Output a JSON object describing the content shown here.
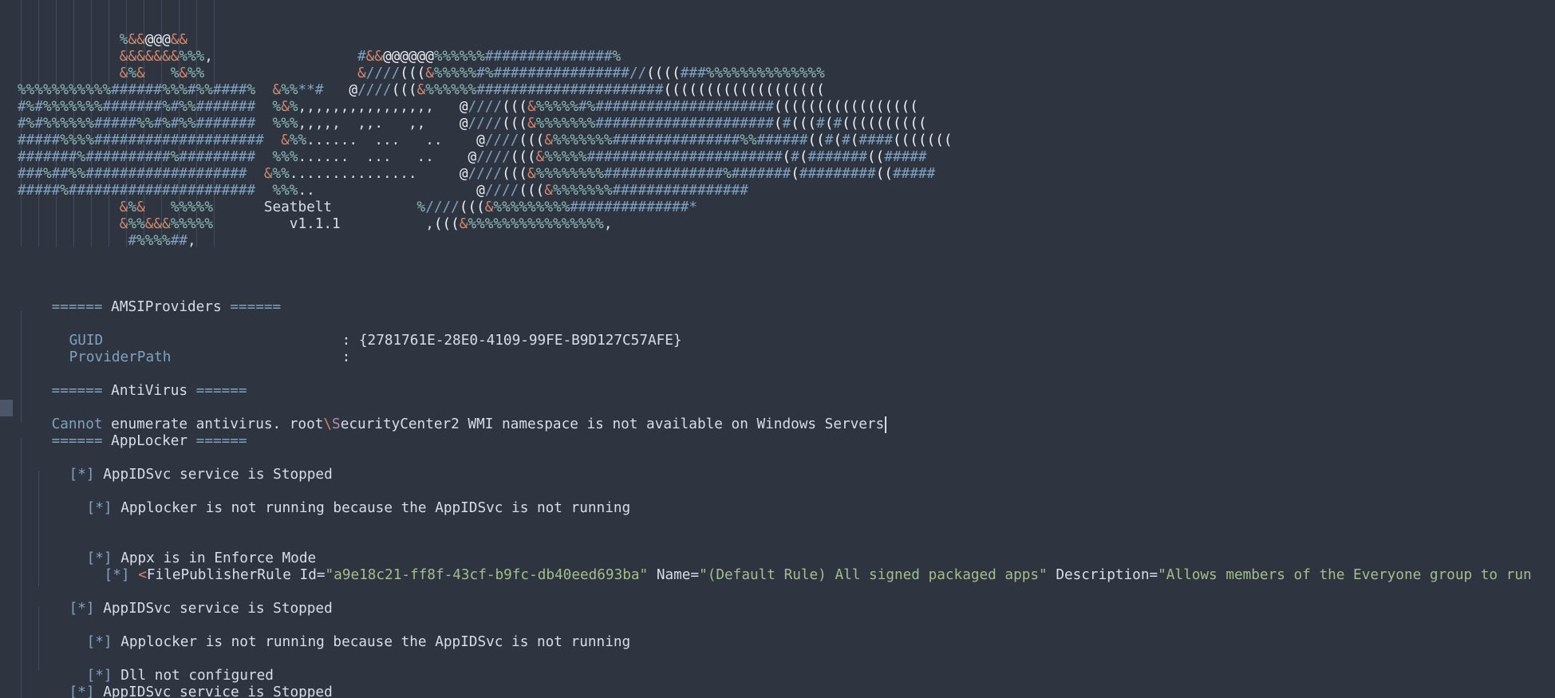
{
  "logo": {
    "ascii_art": [
      "            %&&@@@&&",
      "            &&&&&&&%%%,                 #&&@@@@@@%%%%%%###############%",
      "            &%&   %&%%                  &////(((&%%%%%#%################//((((###%%%%%%%%%%%%%%",
      "%%%%%%%%%%%######%%%#%%####%  &%%**#   @////(((&%%%%%%######################(((((((((((((((((((",
      "#%#%%%%%%%#######%#%%#######  %&%,,,,,,,,,,,,,,,,   @////(((&%%%%%#%#####################(((((((((((((((((",
      "#%#%%%%%%#####%%#%#%%#######  %%%,,,,,  ,,.   ,,    @////(((&%%%%%%%#####################(#(((#(#((((((((((",
      "#####%%%%####################  &%%......  ...   ..    @////(((&%%%%%%%###############%%######((#(#(####(((((((",
      "#######%##########%#########  %%%......  ...   ..    @////(((&%%%%%#######################(#(#######((#####",
      "###%##%%###################  &%%...............     @////(((&%%%%%%%%##############%#######(#########((#####",
      "#####%######################  %%%..                   @////(((&%%%%%%%################",
      "            &%&   %%%%%      Seatbelt          %////(((&%%%%%%%%%##############*",
      "            &%%&&&%%%%%         v1.1.1          ,(((&%%%%%%%%%%%%%%%%,",
      "             #%%%%##,"
    ],
    "title": "Seatbelt",
    "version": "v1.1.1"
  },
  "sections": {
    "amsi_header": "====== AMSIProviders ======",
    "amsi_sep": "======",
    "amsi_title": "AMSIProviders",
    "guid_key": "GUID",
    "guid_value": ": {2781761E-28E0-4109-99FE-B9D127C57AFE}",
    "provider_key": "ProviderPath",
    "provider_value": ":",
    "av_title": "AntiVirus",
    "av_msg_cannot": "Cannot",
    "av_msg_rest1": " enumerate antivirus. root",
    "av_msg_bs": "\\",
    "av_msg_s": "S",
    "av_msg_rest2": "ecurityCenter2 WMI namespace is not available on Windows Servers",
    "applocker_title": "AppLocker",
    "bullet": "[*]",
    "appidsvc_stopped": " AppIDSvc service is Stopped",
    "applocker_not_running": " Applocker is not running because the AppIDSvc is not running",
    "appx_enforce": " Appx is in Enforce Mode",
    "rule_lt": "<",
    "rule_tag": "FilePublisherRule",
    "rule_id_attr": " Id=",
    "rule_id_val": "\"a9e18c21-ff8f-43cf-b9fc-db40eed693ba\"",
    "rule_name_attr": " Name=",
    "rule_name_val": "\"(Default Rule) All signed packaged apps\"",
    "rule_desc_attr": " Description=",
    "rule_desc_val": "\"Allows members of the Everyone group to run",
    "dll_not_configured": " Dll not configured"
  },
  "colors": {
    "background": "#2e3440",
    "text": "#d8dee9",
    "keyword_blue": "#81a1c1",
    "string_green": "#a3be8c",
    "symbol_red": "#d2876f"
  }
}
